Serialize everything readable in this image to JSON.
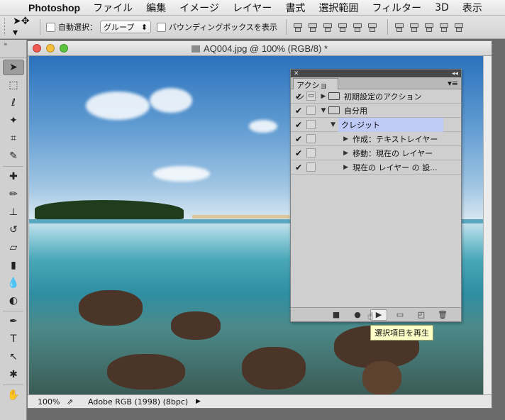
{
  "menubar": {
    "app_name": "Photoshop",
    "items": [
      "ファイル",
      "編集",
      "イメージ",
      "レイヤー",
      "書式",
      "選択範囲",
      "フィルター",
      "3D",
      "表示"
    ]
  },
  "options_bar": {
    "auto_select_label": "自動選択：",
    "auto_select_value": "グループ",
    "bounding_box_label": "バウンディングボックスを表示"
  },
  "document": {
    "title": "AQ004.jpg @ 100% (RGB/8) *",
    "zoom": "100%",
    "profile": "Adobe RGB (1998) (8bpc)"
  },
  "actions_panel": {
    "tab_label": "アクション",
    "rows": [
      {
        "label": "初期設定のアクション",
        "checked": true,
        "kind": "set",
        "expanded": false
      },
      {
        "label": "自分用",
        "checked": true,
        "kind": "set",
        "expanded": true
      },
      {
        "label": "クレジット",
        "checked": true,
        "kind": "action",
        "expanded": true,
        "selected": true
      },
      {
        "label": "作成：テキストレイヤー",
        "checked": true,
        "kind": "step"
      },
      {
        "label": "移動：現在の レイヤー",
        "checked": true,
        "kind": "step"
      },
      {
        "label": "現在の レイヤー の 設...",
        "checked": true,
        "kind": "step"
      }
    ]
  },
  "tooltip": "選択項目を再生",
  "colors": {
    "menu_bg": "#e8e8e8",
    "panel_bg": "#cfcfcf",
    "selection": "#bfcaf5",
    "tooltip_bg": "#ffffc8"
  }
}
